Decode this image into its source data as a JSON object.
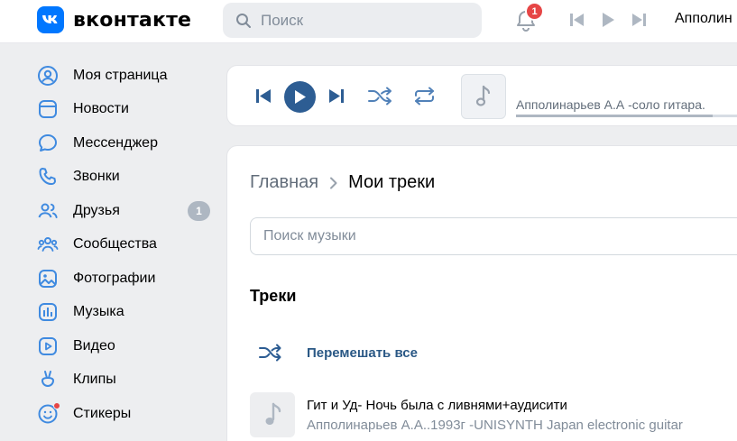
{
  "header": {
    "logo_text": "вконтакте",
    "search_placeholder": "Поиск",
    "notifications_count": "1",
    "now_playing_short": "Апполин"
  },
  "sidebar": {
    "items": [
      {
        "label": "Моя страница",
        "icon": "user-circle-icon"
      },
      {
        "label": "Новости",
        "icon": "news-icon"
      },
      {
        "label": "Мессенджер",
        "icon": "chat-bubble-icon"
      },
      {
        "label": "Звонки",
        "icon": "phone-icon"
      },
      {
        "label": "Друзья",
        "icon": "friends-icon",
        "badge": "1"
      },
      {
        "label": "Сообщества",
        "icon": "communities-icon"
      },
      {
        "label": "Фотографии",
        "icon": "photo-icon"
      },
      {
        "label": "Музыка",
        "icon": "music-icon"
      },
      {
        "label": "Видео",
        "icon": "video-icon"
      },
      {
        "label": "Клипы",
        "icon": "clips-icon"
      },
      {
        "label": "Стикеры",
        "icon": "sticker-icon"
      }
    ]
  },
  "player": {
    "track_title": "Апполинарьев А.А -соло гитара.",
    "progress": 0.84
  },
  "main": {
    "breadcrumb": {
      "home": "Главная",
      "current": "Мои треки"
    },
    "search_placeholder": "Поиск музыки",
    "section_title": "Треки",
    "shuffle_label": "Перемешать все",
    "tracks": [
      {
        "title": "Гит и Уд- Ночь была с ливнями+аудисити",
        "artist": "Апполинарьев А.А..1993г -UNISYNTH Japan electronic guitar"
      }
    ]
  },
  "colors": {
    "accent": "#0077ff",
    "play_button": "#2d5d93",
    "icon_blue": "#3f8ae0",
    "link": "#2a5885",
    "badge_red": "#e64646"
  }
}
